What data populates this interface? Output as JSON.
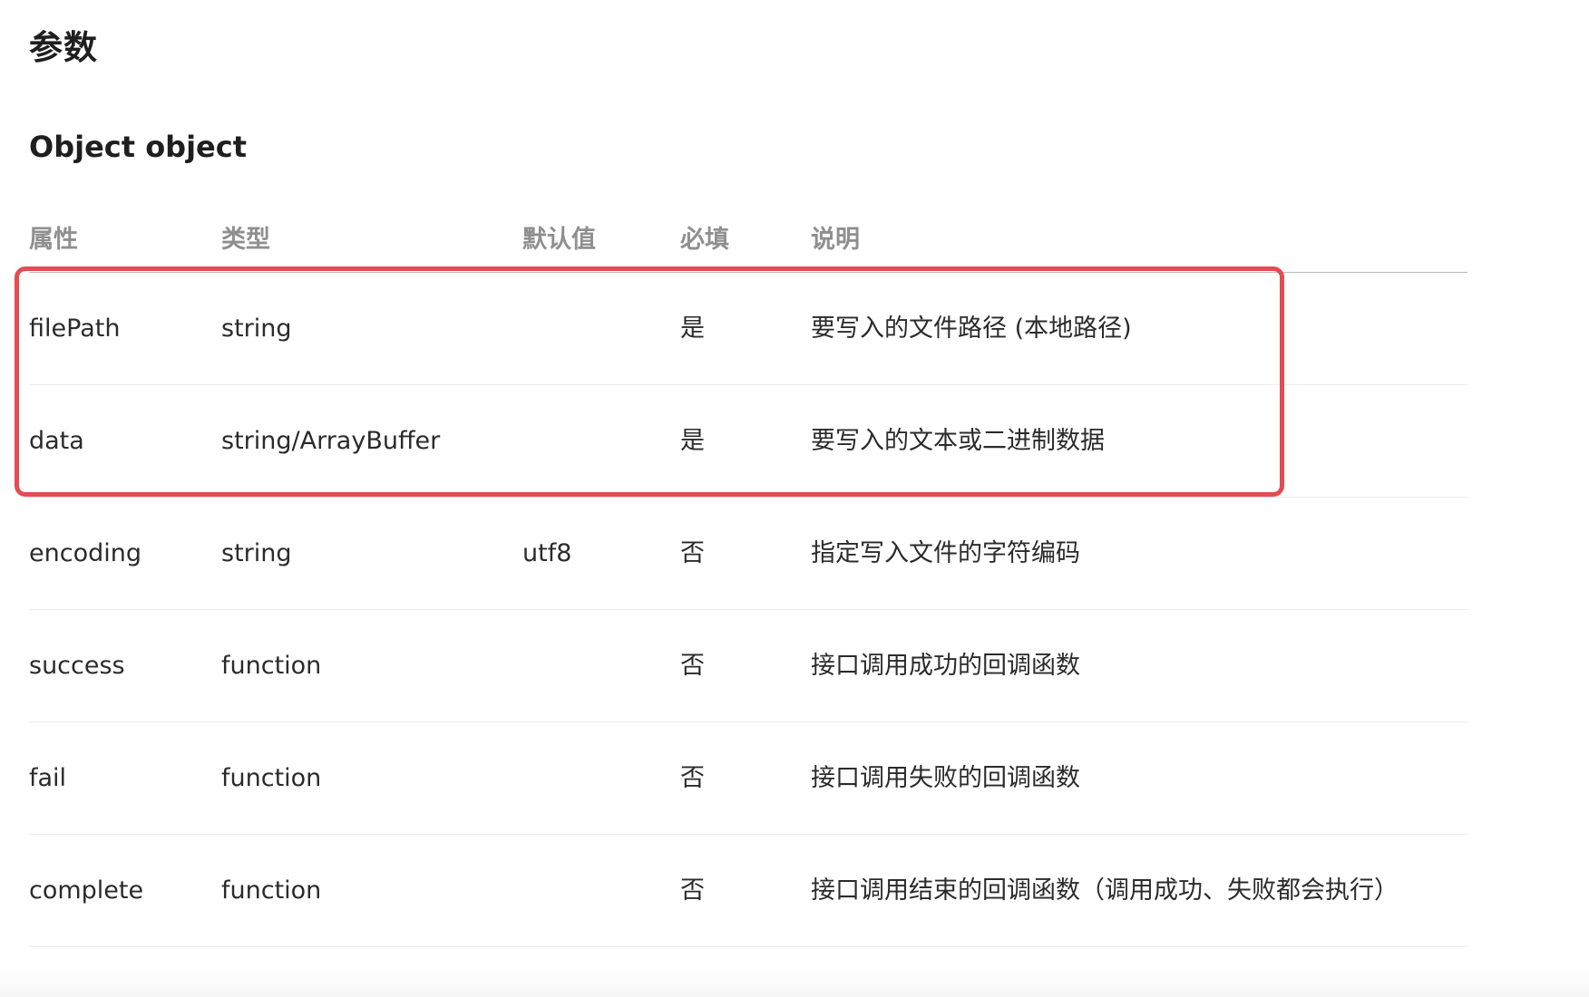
{
  "page": {
    "section_title": "参数",
    "subsection_title": "Object object"
  },
  "table": {
    "headers": [
      "属性",
      "类型",
      "默认值",
      "必填",
      "说明"
    ],
    "rows": [
      [
        "filePath",
        "string",
        "",
        "是",
        "要写入的文件路径 (本地路径)"
      ],
      [
        "data",
        "string/ArrayBuffer",
        "",
        "是",
        "要写入的文本或二进制数据"
      ],
      [
        "encoding",
        "string",
        "utf8",
        "否",
        "指定写入文件的字符编码"
      ],
      [
        "success",
        "function",
        "",
        "否",
        "接口调用成功的回调函数"
      ],
      [
        "fail",
        "function",
        "",
        "否",
        "接口调用失败的回调函数"
      ],
      [
        "complete",
        "function",
        "",
        "否",
        "接口调用结束的回调函数（调用成功、失败都会执行）"
      ]
    ]
  },
  "annotation": {
    "highlight_color": "#e44c52",
    "highlighted_rows": [
      "filePath",
      "data"
    ]
  }
}
